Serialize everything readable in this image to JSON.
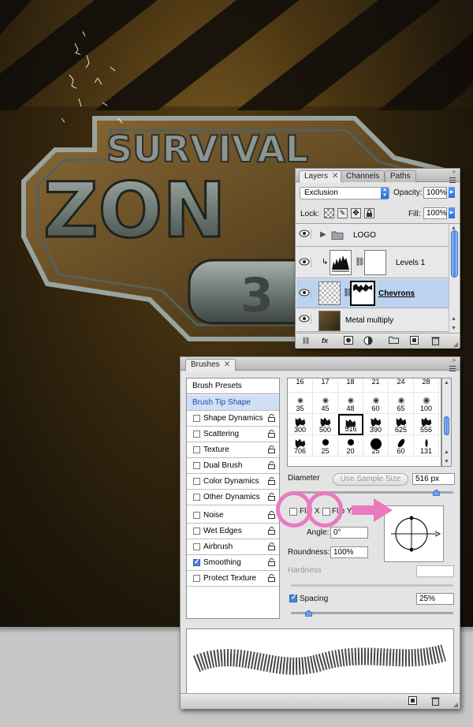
{
  "artwork": {
    "line1": "SURVIVAL",
    "line2": "ZON",
    "line3": "3",
    "colors": {
      "rust": "#6b4a1c",
      "metal": "#7d8a86",
      "stripe": "#0e0c0a"
    }
  },
  "layers_panel": {
    "tabs": [
      "Layers",
      "Channels",
      "Paths"
    ],
    "active_tab": "Layers",
    "blend_mode": "Exclusion",
    "opacity_label": "Opacity:",
    "opacity_value": "100%",
    "lock_label": "Lock:",
    "fill_label": "Fill:",
    "fill_value": "100%",
    "layers": [
      {
        "name": "LOGO",
        "kind": "group",
        "visible": true
      },
      {
        "name": "Levels 1",
        "kind": "adjustment",
        "visible": true
      },
      {
        "name": "Chevrons",
        "kind": "masked",
        "visible": true,
        "selected": true
      },
      {
        "name": "Metal multiply",
        "kind": "texture",
        "visible": true
      }
    ],
    "bottom_icons": [
      "link-icon",
      "fx-icon",
      "mask-icon",
      "adjustment-icon",
      "folder-icon",
      "new-layer-icon",
      "trash-icon"
    ],
    "fx_label": "fx"
  },
  "brushes_panel": {
    "tab": "Brushes",
    "sidebar": {
      "brush_presets": "Brush Presets",
      "brush_tip_shape": "Brush Tip Shape",
      "options": [
        {
          "label": "Shape Dynamics",
          "checked": false,
          "lock": true
        },
        {
          "label": "Scattering",
          "checked": false,
          "lock": true
        },
        {
          "label": "Texture",
          "checked": false,
          "lock": true
        },
        {
          "label": "Dual Brush",
          "checked": false,
          "lock": true
        },
        {
          "label": "Color Dynamics",
          "checked": false,
          "lock": true
        },
        {
          "label": "Other Dynamics",
          "checked": false,
          "lock": true
        },
        {
          "label": "Noise",
          "checked": false,
          "lock": true
        },
        {
          "label": "Wet Edges",
          "checked": false,
          "lock": true
        },
        {
          "label": "Airbrush",
          "checked": false,
          "lock": true
        },
        {
          "label": "Smoothing",
          "checked": true,
          "lock": true
        },
        {
          "label": "Protect Texture",
          "checked": false,
          "lock": true
        }
      ]
    },
    "tips": [
      [
        "16",
        "17",
        "18",
        "21",
        "24",
        "28"
      ],
      [
        "35",
        "45",
        "48",
        "60",
        "65",
        "100"
      ],
      [
        "300",
        "500",
        "516",
        "390",
        "625",
        "556"
      ],
      [
        "706",
        "25",
        "20",
        "25",
        "60",
        "131"
      ]
    ],
    "selected_tip": "516",
    "diameter_label": "Diameter",
    "use_sample_size": "Use Sample Size",
    "diameter_value": "516 px",
    "flip_x_label": "Flip X",
    "flip_y_label": "Flip Y",
    "angle_label": "Angle:",
    "angle_value": "0°",
    "roundness_label": "Roundness:",
    "roundness_value": "100%",
    "hardness_label": "Hardness",
    "spacing_label": "Spacing",
    "spacing_checked": true,
    "spacing_value": "25%"
  },
  "annotation": {
    "color": "#e87bbf"
  }
}
